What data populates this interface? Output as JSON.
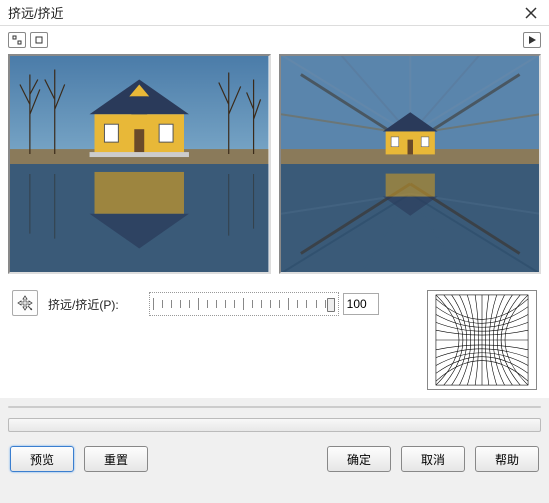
{
  "window": {
    "title": "挤远/挤近"
  },
  "slider": {
    "label": "挤远/挤近(P):",
    "value": "100",
    "min": -100,
    "max": 100
  },
  "buttons": {
    "preview": "预览",
    "reset": "重置",
    "ok": "确定",
    "cancel": "取消",
    "help": "帮助"
  },
  "icons": {
    "expand": "expand-icon",
    "collapse": "collapse-icon",
    "play": "play-icon",
    "pan": "pan-icon"
  }
}
